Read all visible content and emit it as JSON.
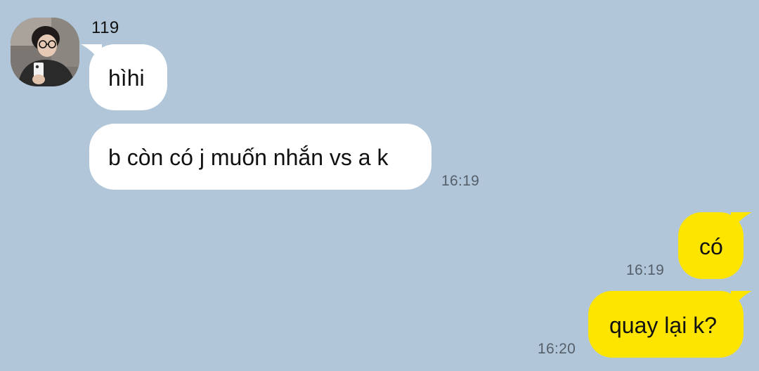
{
  "chat": {
    "sender_name": "119",
    "colors": {
      "background": "#b1c6d9",
      "incoming_bubble": "#ffffff",
      "outgoing_bubble": "#fee500",
      "timestamp": "#555f69"
    },
    "messages": [
      {
        "direction": "incoming",
        "text": "hìhi",
        "time": ""
      },
      {
        "direction": "incoming",
        "text": "b còn có j muốn nhắn vs a k",
        "time": "16:19"
      },
      {
        "direction": "outgoing",
        "text": "có",
        "time": "16:19"
      },
      {
        "direction": "outgoing",
        "text": "quay lại k?",
        "time": "16:20"
      }
    ],
    "avatar_icon": "profile-photo-icon"
  }
}
